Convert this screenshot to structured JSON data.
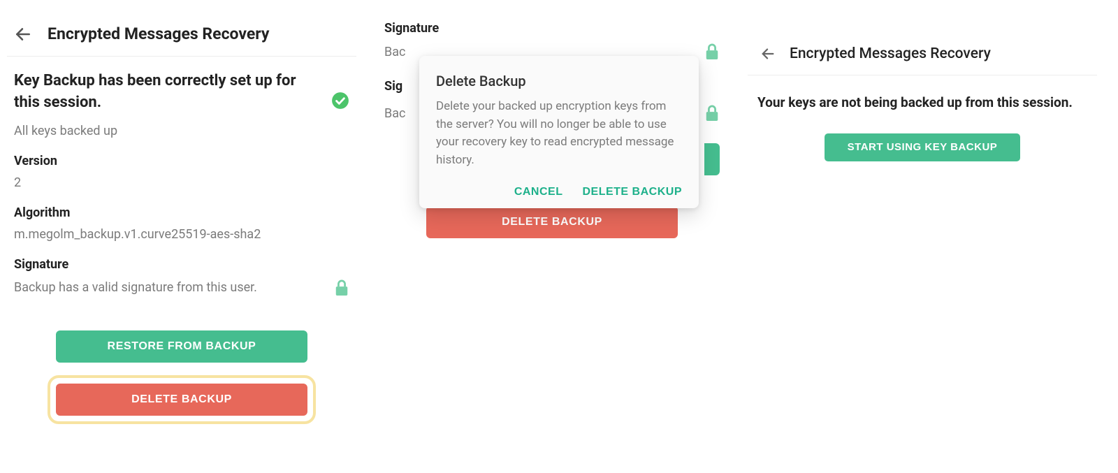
{
  "panel1": {
    "header": {
      "title": "Encrypted Messages Recovery"
    },
    "status": "Key Backup has been correctly set up for this session.",
    "sub": "All keys backed up",
    "version": {
      "label": "Version",
      "value": "2"
    },
    "algorithm": {
      "label": "Algorithm",
      "value": "m.megolm_backup.v1.curve25519-aes-sha2"
    },
    "signature": {
      "label": "Signature",
      "text": "Backup has a valid signature from this user."
    },
    "buttons": {
      "restore": "RESTORE FROM BACKUP",
      "delete": "DELETE BACKUP"
    }
  },
  "panel2": {
    "bg": {
      "sig_label": "Signature",
      "sig_text_clipped": "Bac",
      "sig2_label_clipped": "Sig",
      "sig2_text_clipped": "Bac"
    },
    "dialog": {
      "title": "Delete Backup",
      "body": "Delete your backed up encryption keys from the server? You will no longer be able to use your recovery key to read encrypted message history.",
      "cancel": "CANCEL",
      "confirm": "DELETE BACKUP"
    },
    "delete_button": "DELETE BACKUP"
  },
  "panel3": {
    "header": {
      "title": "Encrypted Messages Recovery"
    },
    "message": "Your keys are not being backed up from this session.",
    "start_button": "START USING KEY BACKUP"
  },
  "colors": {
    "green": "#45bd8f",
    "red": "#e7685a",
    "teal_text": "#1db08a",
    "highlight": "#f7e3a1"
  }
}
